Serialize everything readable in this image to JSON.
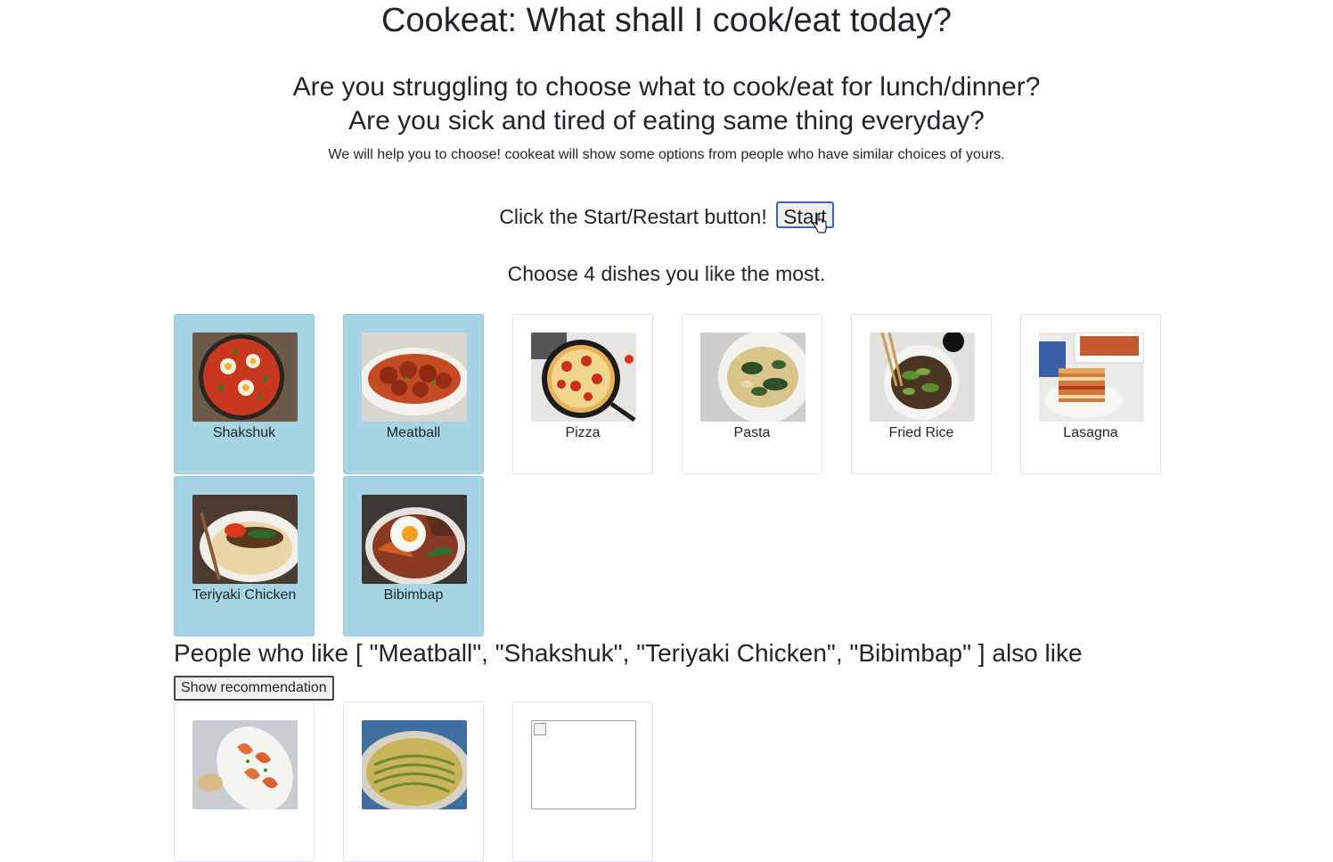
{
  "header": {
    "title": "Cookeat: What shall I cook/eat today?",
    "subtitle_line1": "Are you struggling to choose what to cook/eat for lunch/dinner?",
    "subtitle_line2": "Are you sick and tired of eating same thing everyday?",
    "intro": "We will help you to choose! cookeat will show some options from people who have similar choices of yours."
  },
  "start": {
    "prompt": "Click the Start/Restart button!",
    "button_label": "Start"
  },
  "selection": {
    "instruction": "Choose 4 dishes you like the most.",
    "dishes": [
      {
        "label": "Shakshuk",
        "selected": true,
        "icon": "shakshuka-photo"
      },
      {
        "label": "Meatball",
        "selected": true,
        "icon": "meatball-photo"
      },
      {
        "label": "Pizza",
        "selected": false,
        "icon": "pizza-photo"
      },
      {
        "label": "Pasta",
        "selected": false,
        "icon": "pasta-photo"
      },
      {
        "label": "Fried Rice",
        "selected": false,
        "icon": "fried-rice-photo"
      },
      {
        "label": "Lasagna",
        "selected": false,
        "icon": "lasagna-photo"
      },
      {
        "label": "Teriyaki Chicken",
        "selected": true,
        "icon": "teriyaki-chicken-photo"
      },
      {
        "label": "Bibimbap",
        "selected": true,
        "icon": "bibimbap-photo"
      }
    ]
  },
  "recommendation": {
    "heading": "People who like [ \"Meatball\", \"Shakshuk\", \"Teriyaki Chicken\", \"Bibimbap\" ] also like",
    "button_label": "Show recommendation",
    "items": [
      {
        "icon": "shrimp-photo"
      },
      {
        "icon": "noodle-plate-photo"
      },
      {
        "icon": "broken-image-icon"
      }
    ]
  },
  "colors": {
    "selected_card": "#a6d4e4",
    "start_button_border": "#3d63b8"
  }
}
